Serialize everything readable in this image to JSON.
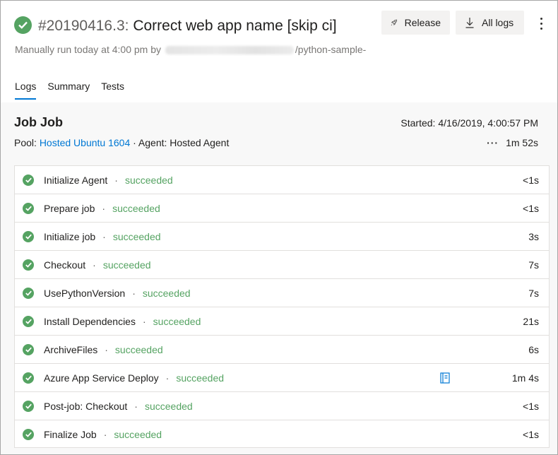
{
  "header": {
    "run_number": "#20190416.3:",
    "run_title": "Correct web app name [skip ci]",
    "subtitle_prefix": "Manually run today at 4:00 pm by",
    "subtitle_suffix": "/python-sample-",
    "release_label": "Release",
    "all_logs_label": "All logs"
  },
  "tabs": [
    {
      "label": "Logs",
      "active": true
    },
    {
      "label": "Summary",
      "active": false
    },
    {
      "label": "Tests",
      "active": false
    }
  ],
  "job": {
    "title": "Job Job",
    "started": "Started: 4/16/2019, 4:00:57 PM",
    "pool_label": "Pool:",
    "pool_name": "Hosted Ubuntu 1604",
    "agent": "· Agent: Hosted Agent",
    "more": "···",
    "duration": "1m 52s"
  },
  "separator": "·",
  "steps": [
    {
      "name": "Initialize Agent",
      "status": "succeeded",
      "duration": "<1s"
    },
    {
      "name": "Prepare job",
      "status": "succeeded",
      "duration": "<1s"
    },
    {
      "name": "Initialize job",
      "status": "succeeded",
      "duration": "3s"
    },
    {
      "name": "Checkout",
      "status": "succeeded",
      "duration": "7s"
    },
    {
      "name": "UsePythonVersion",
      "status": "succeeded",
      "duration": "7s"
    },
    {
      "name": "Install Dependencies",
      "status": "succeeded",
      "duration": "21s"
    },
    {
      "name": "ArchiveFiles",
      "status": "succeeded",
      "duration": "6s"
    },
    {
      "name": "Azure App Service Deploy",
      "status": "succeeded",
      "duration": "1m 4s",
      "has_icon": true
    },
    {
      "name": "Post-job: Checkout",
      "status": "succeeded",
      "duration": "<1s"
    },
    {
      "name": "Finalize Job",
      "status": "succeeded",
      "duration": "<1s"
    }
  ],
  "colors": {
    "success": "#55a362",
    "accent": "#0078d4"
  }
}
